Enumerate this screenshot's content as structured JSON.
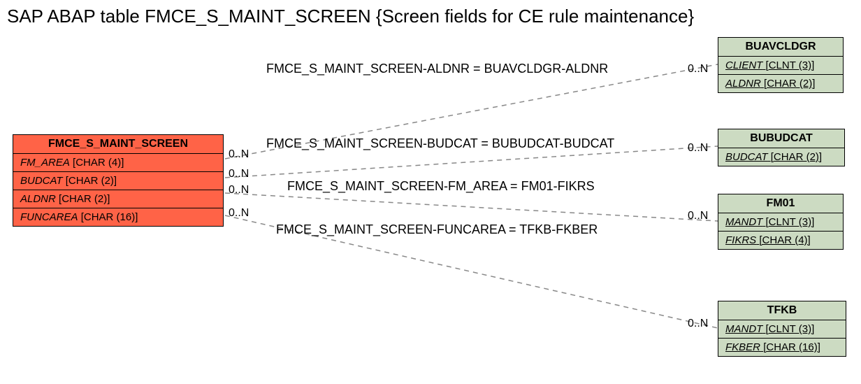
{
  "title": "SAP ABAP table FMCE_S_MAINT_SCREEN {Screen fields for CE rule maintenance}",
  "source_entity": {
    "name": "FMCE_S_MAINT_SCREEN",
    "fields": [
      {
        "name": "FM_AREA",
        "type": "CHAR (4)",
        "pk": false
      },
      {
        "name": "BUDCAT",
        "type": "CHAR (2)",
        "pk": false
      },
      {
        "name": "ALDNR",
        "type": "CHAR (2)",
        "pk": false
      },
      {
        "name": "FUNCAREA",
        "type": "CHAR (16)",
        "pk": false
      }
    ]
  },
  "target_entities": [
    {
      "name": "BUAVCLDGR",
      "fields": [
        {
          "name": "CLIENT",
          "type": "CLNT (3)",
          "pk": true
        },
        {
          "name": "ALDNR",
          "type": "CHAR (2)",
          "pk": true
        }
      ]
    },
    {
      "name": "BUBUDCAT",
      "fields": [
        {
          "name": "BUDCAT",
          "type": "CHAR (2)",
          "pk": true
        }
      ]
    },
    {
      "name": "FM01",
      "fields": [
        {
          "name": "MANDT",
          "type": "CLNT (3)",
          "pk": true
        },
        {
          "name": "FIKRS",
          "type": "CHAR (4)",
          "pk": true
        }
      ]
    },
    {
      "name": "TFKB",
      "fields": [
        {
          "name": "MANDT",
          "type": "CLNT (3)",
          "pk": true
        },
        {
          "name": "FKBER",
          "type": "CHAR (16)",
          "pk": true
        }
      ]
    }
  ],
  "relations": [
    {
      "label": "FMCE_S_MAINT_SCREEN-ALDNR = BUAVCLDGR-ALDNR",
      "card_left": "0..N",
      "card_right": "0..N"
    },
    {
      "label": "FMCE_S_MAINT_SCREEN-BUDCAT = BUBUDCAT-BUDCAT",
      "card_left": "0..N",
      "card_right": "0..N"
    },
    {
      "label": "FMCE_S_MAINT_SCREEN-FM_AREA = FM01-FIKRS",
      "card_left": "0..N",
      "card_right": "0..N"
    },
    {
      "label": "FMCE_S_MAINT_SCREEN-FUNCAREA = TFKB-FKBER",
      "card_left": "0..N",
      "card_right": "0..N"
    }
  ]
}
